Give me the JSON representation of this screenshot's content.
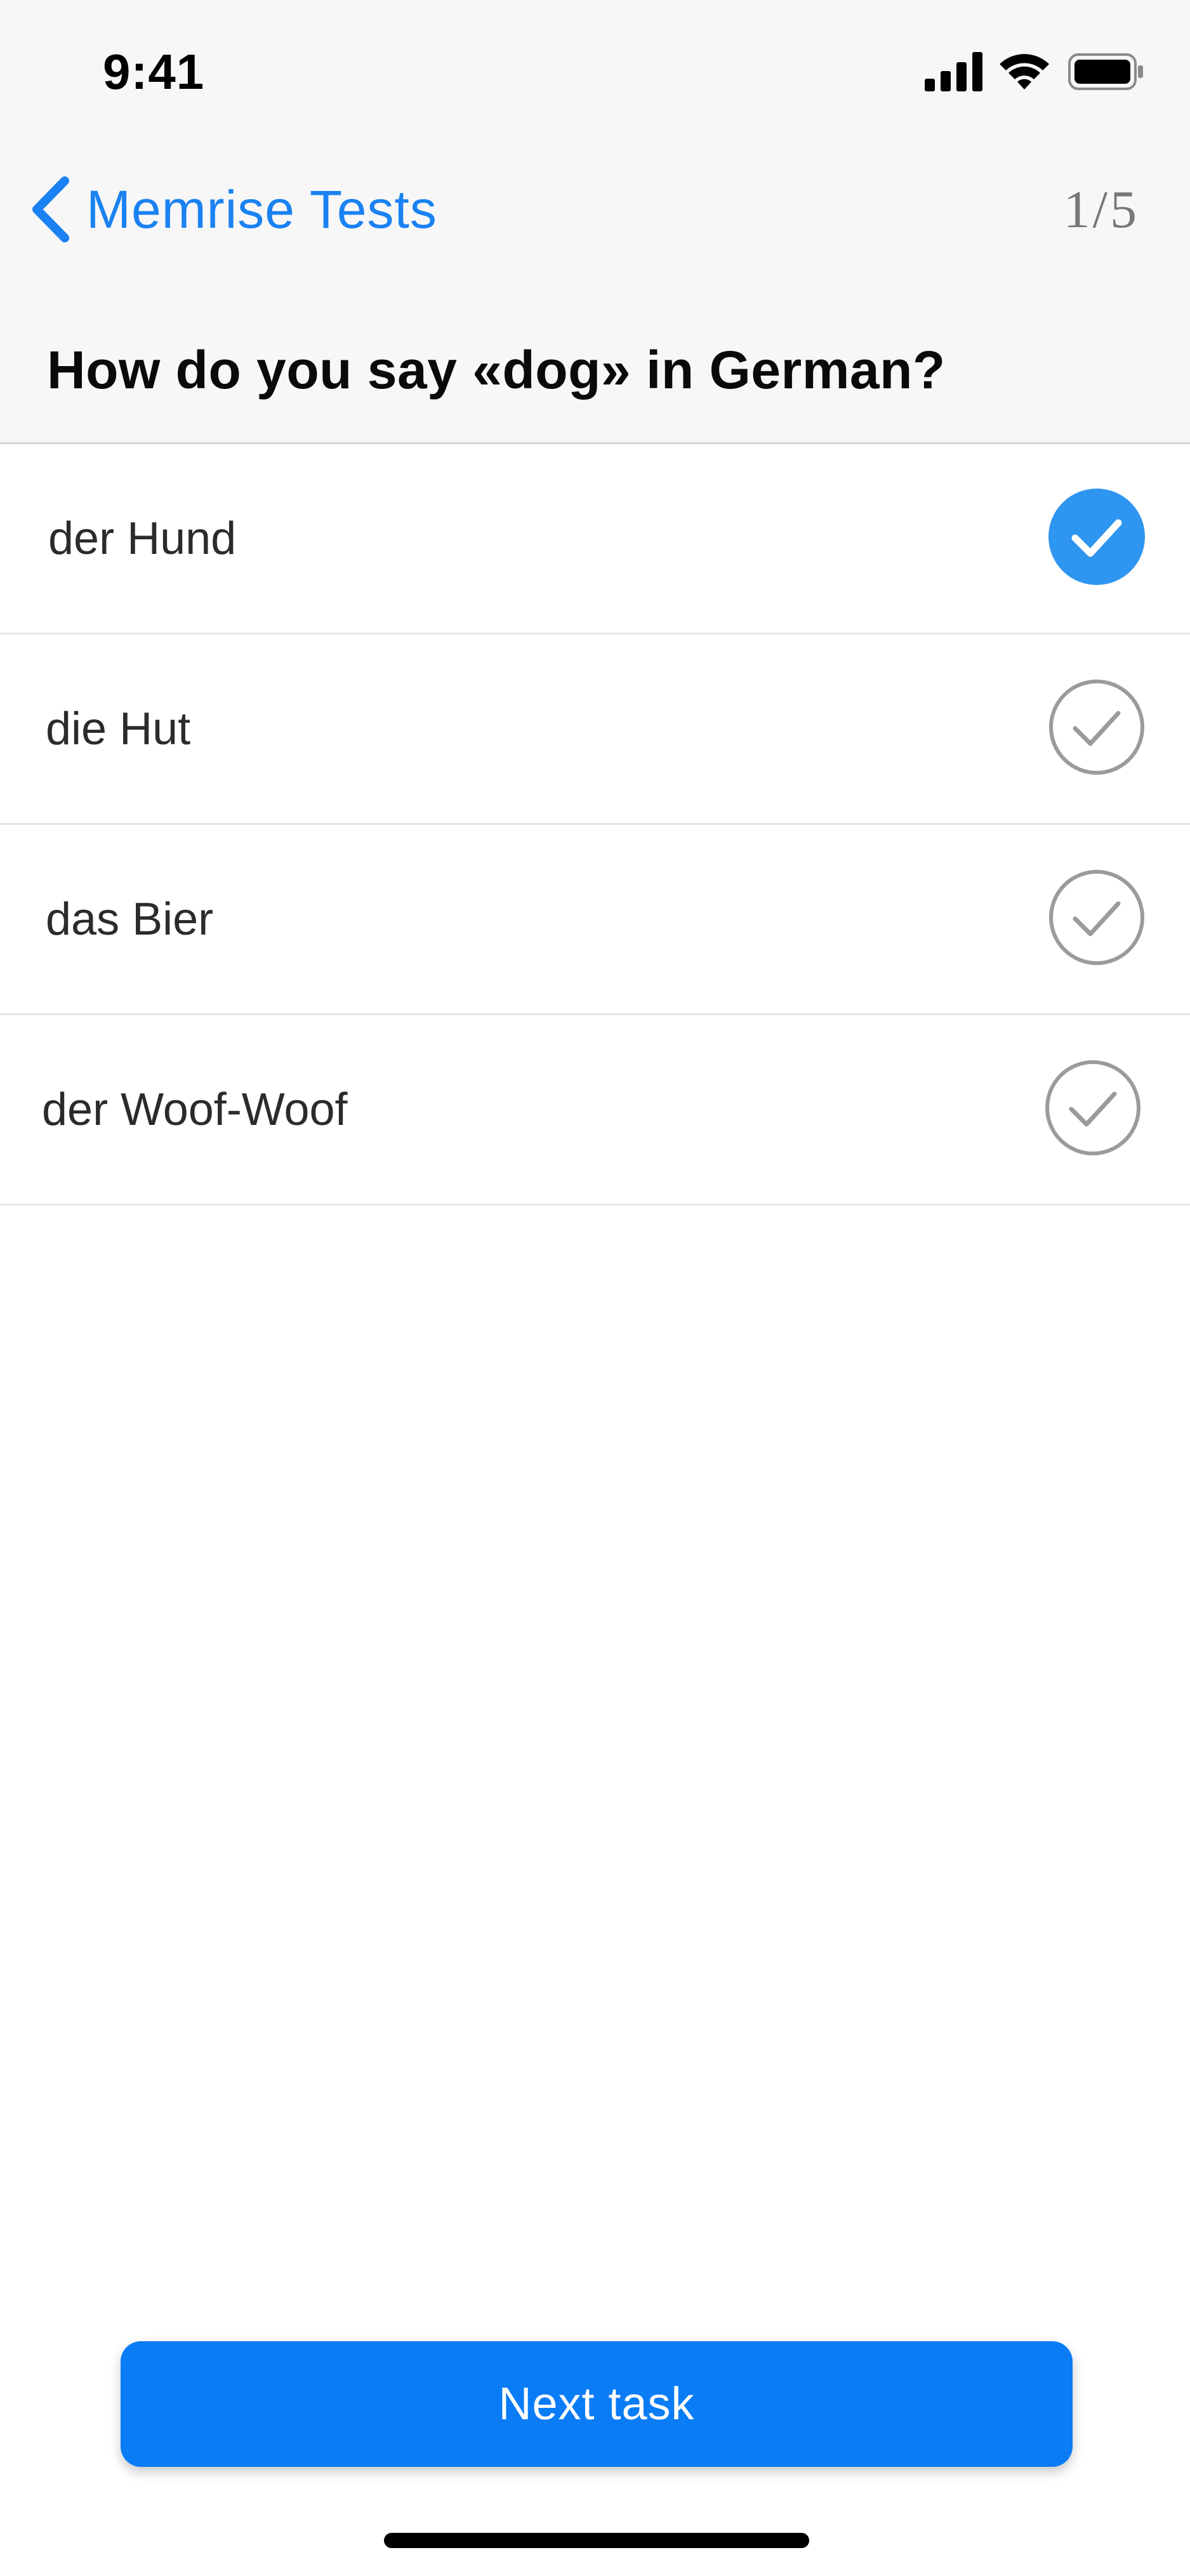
{
  "status_bar": {
    "time": "9:41",
    "icons": [
      "cellular-signal-icon",
      "wifi-icon",
      "battery-icon"
    ]
  },
  "nav": {
    "back_icon": "chevron-left-icon",
    "back_label": "Memrise Tests",
    "progress": "1/5"
  },
  "question": "How do you say «dog» in German?",
  "answers": [
    {
      "label": "der Hund",
      "selected": true
    },
    {
      "label": "die Hut",
      "selected": false
    },
    {
      "label": "das Bier",
      "selected": false
    },
    {
      "label": "der Woof-Woof",
      "selected": false
    }
  ],
  "next_button": {
    "label": "Next task"
  },
  "colors": {
    "accent": "#1a82f2",
    "button": "#0a7cf5",
    "selected_check": "#2e95f0",
    "unselected_check": "#9b9b9b",
    "header_bg": "#f7f7f7"
  }
}
